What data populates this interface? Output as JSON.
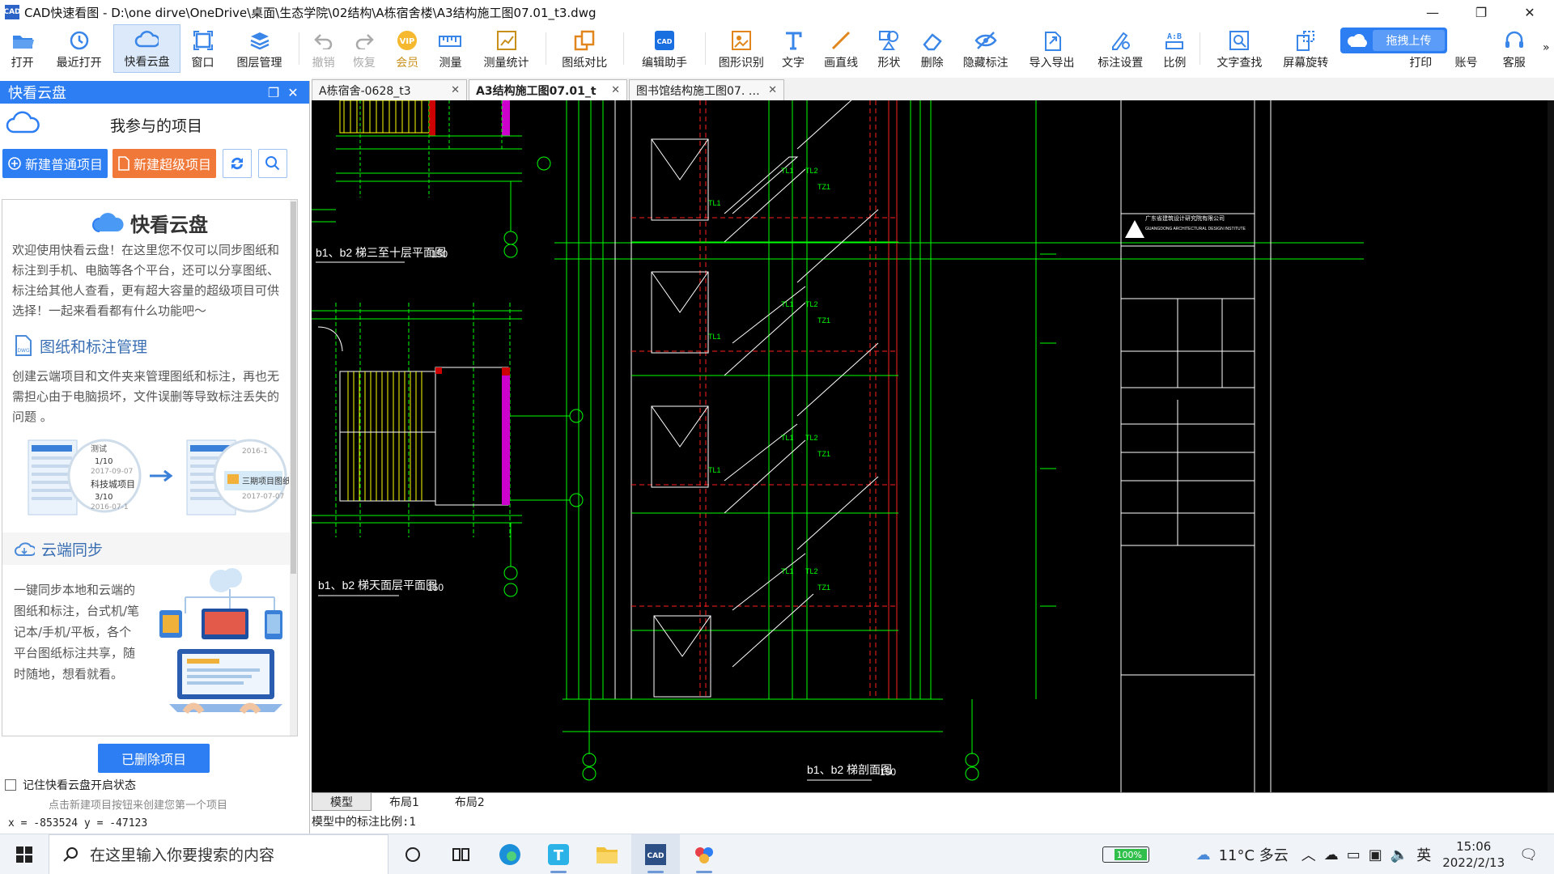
{
  "window": {
    "title": "CAD快速看图 - D:\\one dirve\\OneDrive\\桌面\\生态学院\\02结构\\A栋宿舍楼\\A3结构施工图07.01_t3.dwg"
  },
  "toolbar": {
    "items": [
      {
        "label": "打开",
        "icon": "folder-open-icon"
      },
      {
        "label": "最近打开",
        "icon": "clock-icon"
      },
      {
        "label": "快看云盘",
        "icon": "cloud-icon"
      },
      {
        "label": "窗口",
        "icon": "window-icon"
      },
      {
        "label": "图层管理",
        "icon": "layers-icon"
      },
      {
        "label": "撤销",
        "icon": "undo-icon"
      },
      {
        "label": "恢复",
        "icon": "redo-icon"
      },
      {
        "label": "会员",
        "icon": "vip-icon"
      },
      {
        "label": "测量",
        "icon": "ruler-icon"
      },
      {
        "label": "测量统计",
        "icon": "stats-icon"
      },
      {
        "label": "图纸对比",
        "icon": "compare-icon"
      },
      {
        "label": "编辑助手",
        "icon": "edit-cad-icon"
      },
      {
        "label": "图形识别",
        "icon": "shape-recognize-icon"
      },
      {
        "label": "文字",
        "icon": "text-icon"
      },
      {
        "label": "画直线",
        "icon": "line-icon"
      },
      {
        "label": "形状",
        "icon": "shape-icon"
      },
      {
        "label": "删除",
        "icon": "eraser-icon"
      },
      {
        "label": "隐藏标注",
        "icon": "hide-annotation-icon"
      },
      {
        "label": "导入导出",
        "icon": "import-export-icon"
      },
      {
        "label": "标注设置",
        "icon": "annotation-settings-icon"
      },
      {
        "label": "比例",
        "icon": "scale-icon"
      },
      {
        "label": "文字查找",
        "icon": "text-search-icon"
      },
      {
        "label": "屏幕旋转",
        "icon": "rotate-icon"
      },
      {
        "label": "打印",
        "icon": "printer-icon"
      },
      {
        "label": "账号",
        "icon": "account-icon"
      },
      {
        "label": "客服",
        "icon": "headset-icon"
      }
    ],
    "upload_label": "拖拽上传",
    "more": "»"
  },
  "panel": {
    "title": "快看云盘",
    "projects_heading": "我参与的项目",
    "new_project": "新建普通项目",
    "new_super_project": "新建超级项目",
    "brand": "快看云盘",
    "intro": "欢迎使用快看云盘！在这里您不仅可以同步图纸和标注到手机、电脑等各个平台，还可以分享图纸、标注给其他人查看，更有超大容量的超级项目可供选择！一起来看看都有什么功能吧～",
    "section1_title": "图纸和标注管理",
    "section1_text": "创建云端项目和文件夹来管理图纸和标注，再也无需担心由于电脑损坏，文件误删等导致标注丢失的问题 。",
    "section1_illus": {
      "left_a": "测试",
      "left_b": "1/10",
      "left_c": "2017-09-07",
      "left_d": "科技城项目",
      "left_e": "3/10",
      "left_f": "2016-07-1",
      "right_a": "2016-1",
      "right_b": "三期项目图纸",
      "right_c": "2017-07-07"
    },
    "section2_title": "云端同步",
    "section2_text": "一键同步本地和云端的图纸和标注，台式机/笔记本/手机/平板，各个平台图纸标注共享，随时随地，想看就看。",
    "deleted_button": "已删除项目",
    "remember_label": "记住快看云盘开启状态",
    "hint": "点击新建项目按钮来创建您第一个项目",
    "coords": "x = -853524  y = -47123"
  },
  "doc_tabs": [
    {
      "label": "A栋宿舍-0628_t3",
      "active": false
    },
    {
      "label": "A3结构施工图07.01_t",
      "active": true
    },
    {
      "label": "图书馆结构施工图07. …",
      "active": false
    }
  ],
  "drawing": {
    "label_b1b2_3to10": "b1、b2 梯三至十层平面图",
    "label_b1b2_section": "b1、b2 梯剖面图",
    "label_b1b2_top": "b1、b2 梯天面层平面图",
    "scale_150": "150",
    "company": "广东省建筑设计研究院有限公司",
    "company_en": "GUANGDONG ARCHITECTURAL DESIGN INSTITUTE"
  },
  "layout_tabs": [
    "模型",
    "布局1",
    "布局2"
  ],
  "status_text": "模型中的标注比例:1",
  "taskbar": {
    "search_placeholder": "在这里输入你要搜索的内容",
    "battery": "100%",
    "weather": "11°C 多云",
    "ime": "英",
    "time": "15:06",
    "date": "2022/2/13"
  },
  "colors": {
    "accent": "#2d7df3",
    "orange": "#f0793a",
    "cad_green": "#00ff00",
    "cad_red": "#ff2020",
    "cad_yellow": "#ffff00",
    "cad_white": "#ffffff",
    "cad_magenta": "#ff00ff"
  }
}
